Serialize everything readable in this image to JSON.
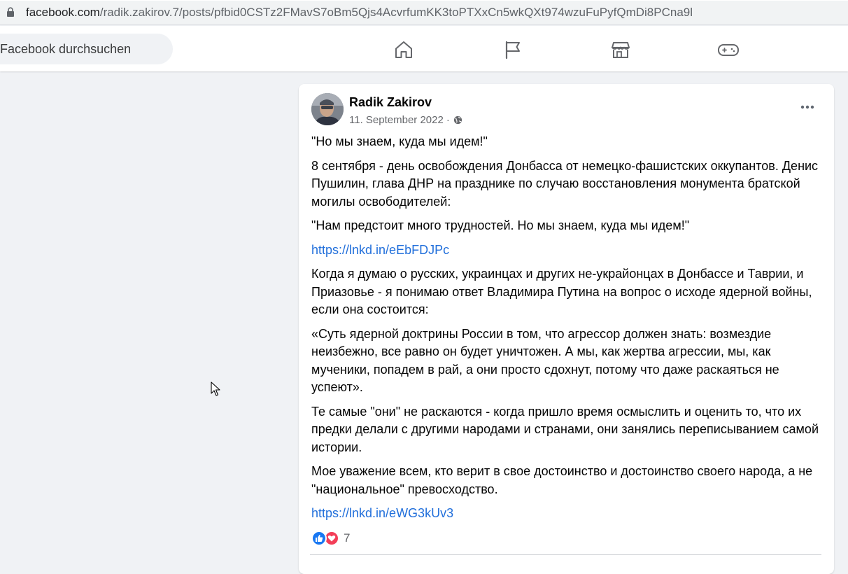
{
  "browser": {
    "url_domain": "facebook.com",
    "url_path": "/radik.zakirov.7/posts/pfbid0CSTz2FMavS7oBm5Qjs4AcvrfumKK3toPTXxCn5wkQXt974wzuFuPyfQmDi8PCna9l"
  },
  "header": {
    "search_placeholder": "Facebook durchsuchen",
    "nav_icons": [
      "home-icon",
      "pages-flag-icon",
      "marketplace-icon",
      "gaming-icon"
    ]
  },
  "post": {
    "author": "Radik Zakirov",
    "date": "11. September 2022",
    "separator": "·",
    "paragraphs": [
      "\"Но мы знаем, куда мы идем!\"",
      "8 сентября - день освобождения Донбасса от немецко-фашистских оккупантов. Денис Пушилин, глава ДНР на празднике по случаю восстановления монумента братской могилы освободителей:",
      "\"Нам предстоит много трудностей. Но мы знаем, куда мы идем!\"",
      "https://lnkd.in/eEbFDJPc",
      "Когда я думаю о русских, украинцах и других не-украйонцах в Донбассе и Таврии, и Приазовье - я понимаю ответ Владимира Путина на вопрос о исходе ядерной войны, если она состоится:",
      "«Суть ядерной доктрины России в том, что агрессор должен знать: возмездие неизбежно, все равно он будет уничтожен. А мы, как жертва агрессии, мы, как мученики, попадем в рай, а они просто сдохнут, потому что даже раскаяться не успеют».",
      "Те самые \"они\" не раскаются - когда пришло время осмыслить и оценить то, что их предки делали с другими народами и странами, они занялись переписыванием самой истории.",
      "Мое уважение всем, кто верит в свое достоинство и достоинство своего народа, а не \"национальное\" превосходство.",
      "https://lnkd.in/eWG3kUv3"
    ],
    "reaction_count": "7",
    "colors": {
      "link": "#216fdb",
      "like": "#1877f2",
      "love": "#f33e58"
    }
  }
}
